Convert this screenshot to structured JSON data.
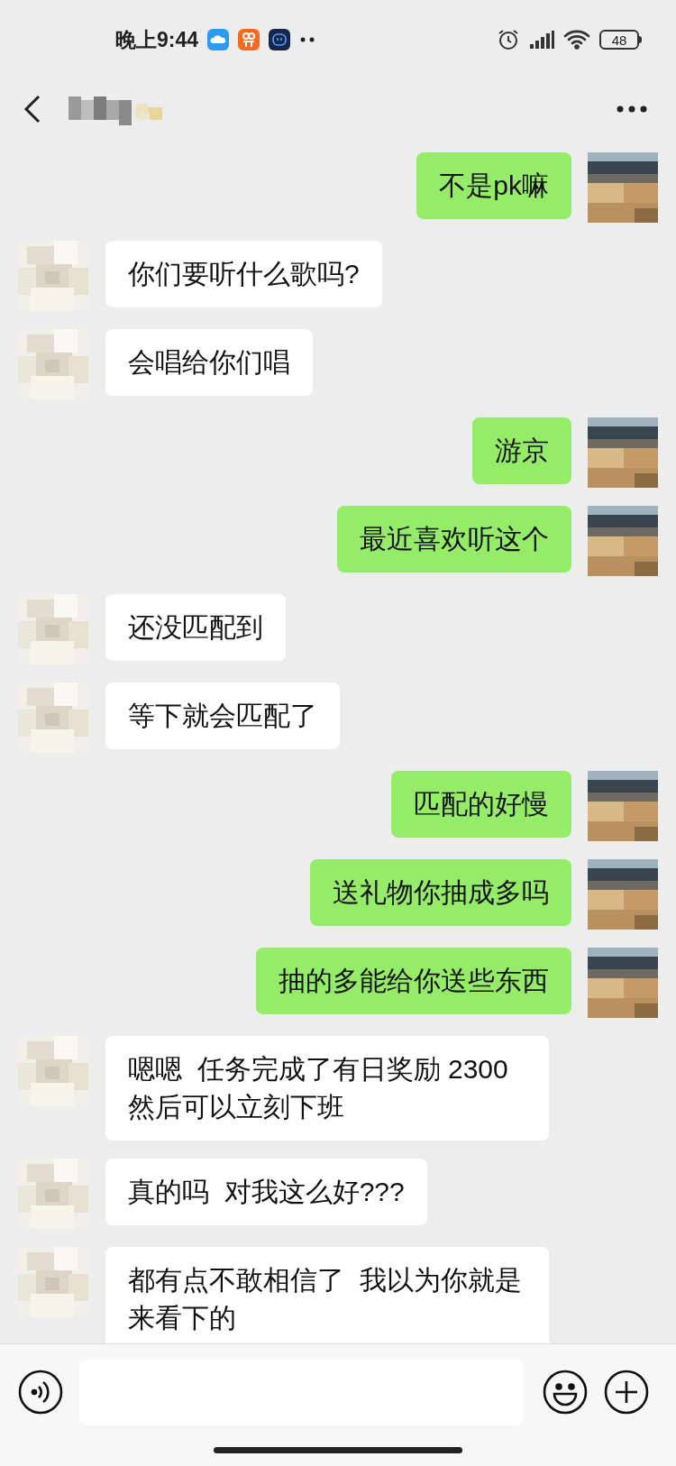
{
  "status_bar": {
    "time": "晚上9:44",
    "battery": "48"
  },
  "header": {
    "name_obscured": true
  },
  "messages": [
    {
      "kind": "sent",
      "text": "不是pk嘛"
    },
    {
      "kind": "received",
      "text": "你们要听什么歌吗?"
    },
    {
      "kind": "received",
      "text": "会唱给你们唱"
    },
    {
      "kind": "sent",
      "text": "游京"
    },
    {
      "kind": "sent",
      "text": "最近喜欢听这个"
    },
    {
      "kind": "received",
      "text": "还没匹配到"
    },
    {
      "kind": "received",
      "text": "等下就会匹配了"
    },
    {
      "kind": "sent",
      "text": "匹配的好慢"
    },
    {
      "kind": "sent",
      "text": "送礼物你抽成多吗"
    },
    {
      "kind": "sent",
      "text": "抽的多能给你送些东西"
    },
    {
      "kind": "received",
      "text": "嗯嗯  任务完成了有日奖励 2300 然后可以立刻下班"
    },
    {
      "kind": "received",
      "text": "真的吗  对我这么好???"
    },
    {
      "kind": "received",
      "text": "都有点不敢相信了  我以为你就是来看下的"
    }
  ]
}
